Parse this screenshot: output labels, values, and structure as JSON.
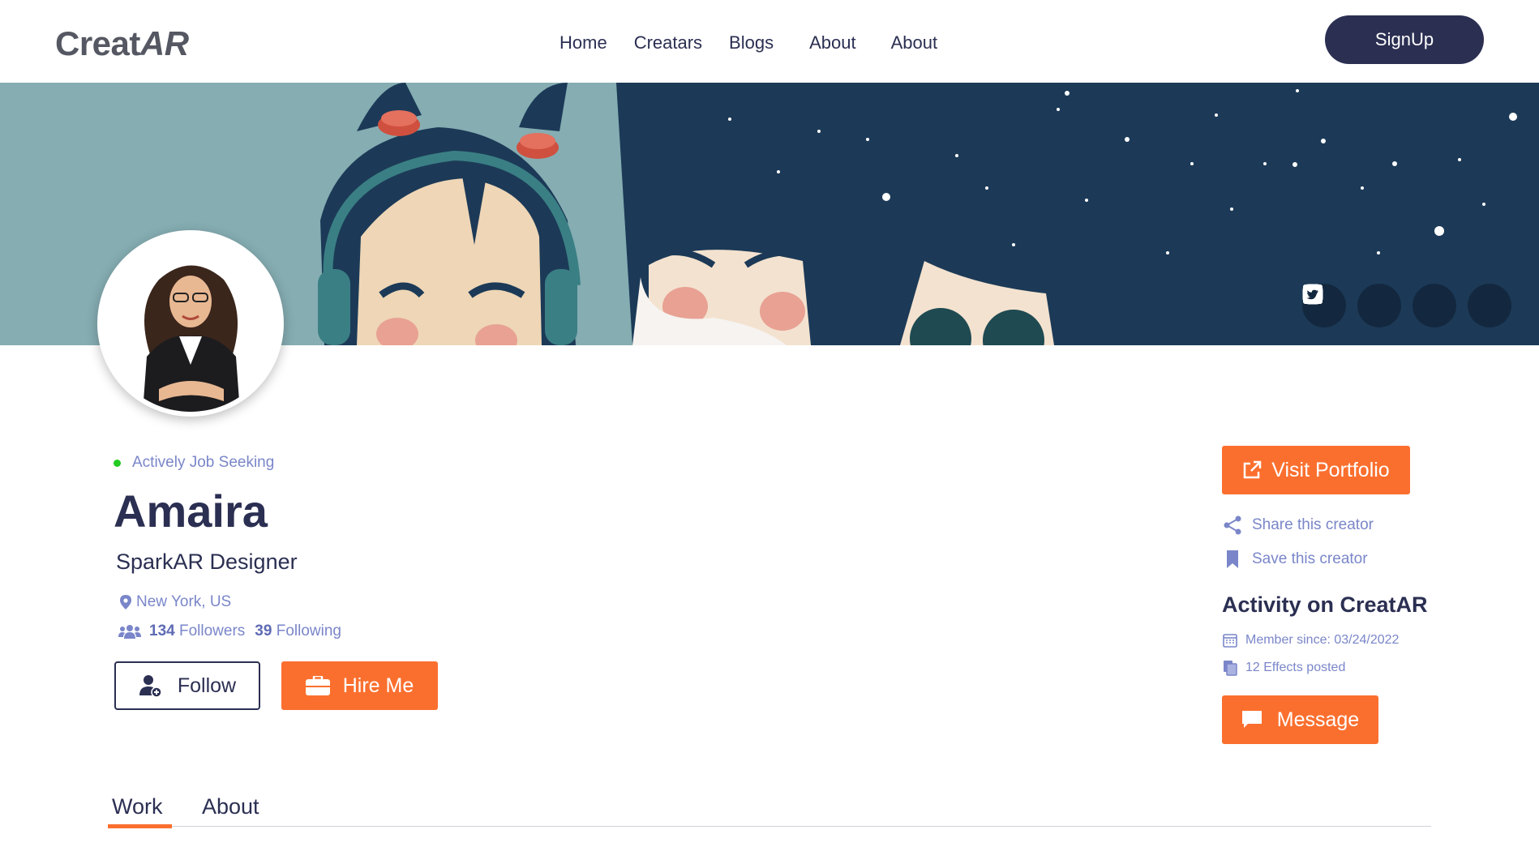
{
  "nav": {
    "logo_text": "Creat",
    "logo_ar": "AR",
    "links": [
      "Home",
      "Creatars",
      "Blogs",
      "About",
      "About"
    ],
    "signup_label": "SignUp"
  },
  "banner": {
    "socials": [
      "instagram-icon",
      "linkedin-icon",
      "facebook-icon",
      "twitter-icon"
    ]
  },
  "profile": {
    "status": "Actively Job Seeking",
    "name": "Amaira",
    "role": "SparkAR Designer",
    "location": "New York, US",
    "followers_count": "134",
    "followers_label": "Followers",
    "following_count": "39",
    "following_label": "Following",
    "follow_label": "Follow",
    "hire_label": "Hire Me"
  },
  "sidebar": {
    "portfolio_label": "Visit Portfolio",
    "share_label": "Share this creator",
    "save_label": "Save this creator",
    "activity_title": "Activity on CreatAR",
    "member_since": "Member since: 03/24/2022",
    "effects_posted": "12 Effects posted",
    "message_label": "Message"
  },
  "tabs": {
    "work": "Work",
    "about": "About"
  },
  "colors": {
    "accent": "#fb6f2e",
    "navy": "#2b2f52",
    "muted": "#7a86c9",
    "online": "#22cc22"
  }
}
